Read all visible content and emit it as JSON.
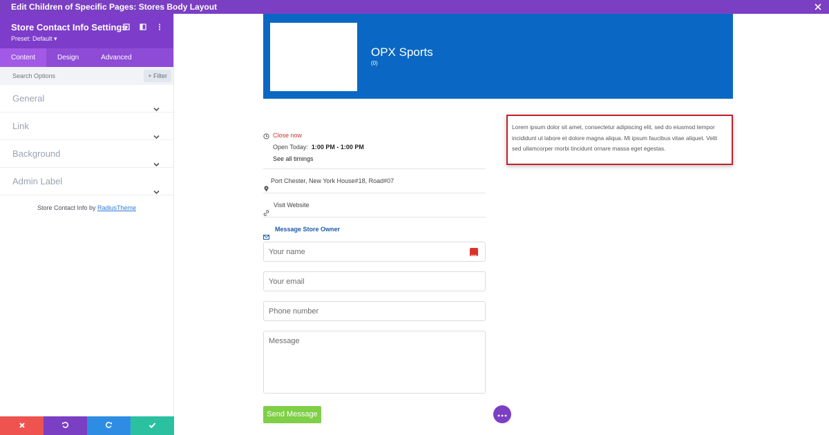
{
  "topbar": {
    "title": "Edit Children of Specific Pages: Stores Body Layout"
  },
  "panel": {
    "title": "Store Contact Info Settings",
    "preset": "Preset: Default ▾",
    "tabs": [
      "Content",
      "Design",
      "Advanced"
    ],
    "search_placeholder": "Search Options",
    "filter_label": "Filter",
    "toggles": [
      "General",
      "Link",
      "Background",
      "Admin Label"
    ],
    "credit_prefix": "Store Contact Info by",
    "credit_link": "RadiusTheme"
  },
  "bottom_bar": {
    "colors": [
      "#ef5350",
      "#7b3fc4",
      "#2e8de3",
      "#2bc0a0"
    ]
  },
  "hero": {
    "store_name": "OPX Sports",
    "rating_count": "(0)"
  },
  "info": {
    "status": "Close now",
    "open_today_label": "Open Today:",
    "open_today_time": "1:00 PM  - 1:00 PM",
    "all_timings": "See all timings",
    "address": "Port Chester, New York House#18, Road#07",
    "website": "Visit Website",
    "message_heading": "Message Store Owner"
  },
  "form": {
    "name_placeholder": "Your name",
    "email_placeholder": "Your email",
    "phone_placeholder": "Phone number",
    "message_placeholder": "Message",
    "send_label": "Send Message"
  },
  "description": "Lorem ipsum dolor sit amet, consectetur adipiscing elit, sed do eiusmod tempor incididunt ut labore et dolore magna aliqua. Mi ipsum faucibus vitae aliquet. Velit sed ullamcorper morbi tincidunt ornare massa eget egestas.",
  "colors": {
    "accent": "#7b3fc4",
    "hero_bg": "#0a68c4",
    "send_bg": "#7fcf47",
    "closed": "#c7342f"
  }
}
